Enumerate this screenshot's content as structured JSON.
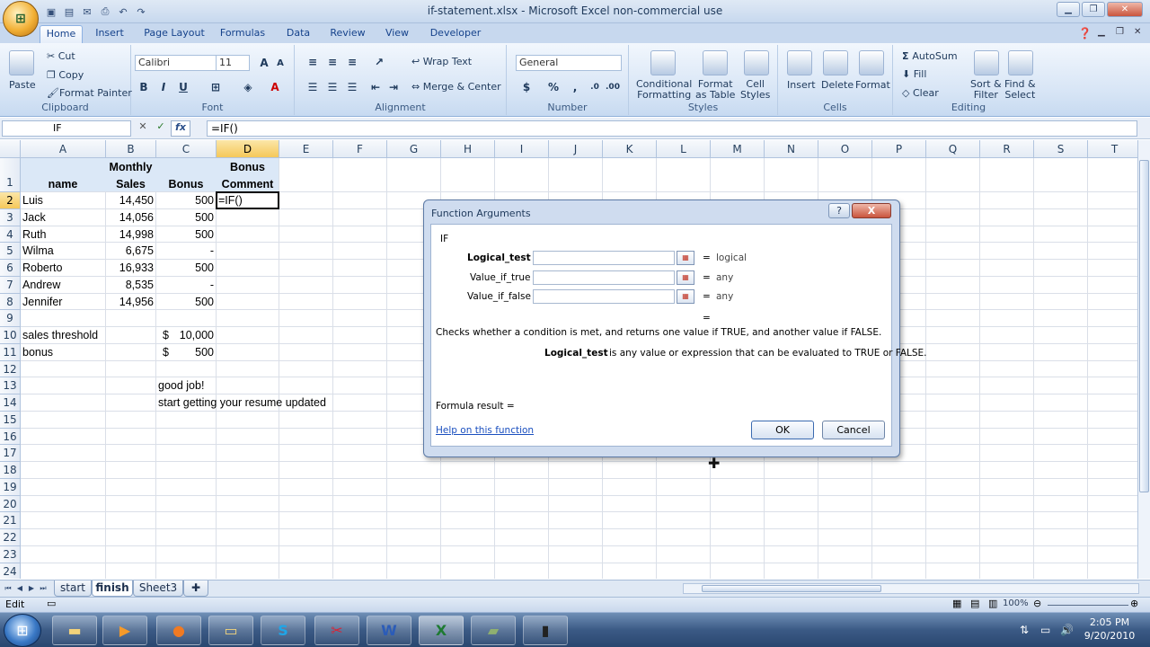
{
  "window": {
    "title": "if-statement.xlsx - Microsoft Excel non-commercial use"
  },
  "tabs": [
    "Home",
    "Insert",
    "Page Layout",
    "Formulas",
    "Data",
    "Review",
    "View",
    "Developer"
  ],
  "ribbon": {
    "clipboard": {
      "paste": "Paste",
      "cut": "Cut",
      "copy": "Copy",
      "format_painter": "Format Painter",
      "label": "Clipboard"
    },
    "font": {
      "name": "Calibri",
      "size": "11",
      "label": "Font",
      "bold": "B",
      "italic": "I",
      "underline": "U"
    },
    "alignment": {
      "wrap": "Wrap Text",
      "merge": "Merge & Center",
      "label": "Alignment"
    },
    "number": {
      "format": "General",
      "dollar": "$",
      "percent": "%",
      "label": "Number"
    },
    "styles": {
      "cond": "Conditional",
      "cond2": "Formatting",
      "fmt": "Format",
      "fmt2": "as Table",
      "cell": "Cell",
      "cell2": "Styles",
      "label": "Styles"
    },
    "cells": {
      "insert": "Insert",
      "delete": "Delete",
      "format": "Format",
      "label": "Cells"
    },
    "editing": {
      "autosum": "AutoSum",
      "fill": "Fill",
      "clear": "Clear",
      "sort": "Sort &",
      "sort2": "Filter",
      "find": "Find &",
      "find2": "Select",
      "label": "Editing"
    }
  },
  "formula_bar": {
    "name_box": "IF",
    "formula": "=IF()",
    "fx": "fx"
  },
  "columns": [
    "A",
    "B",
    "C",
    "D",
    "E",
    "F",
    "G",
    "H",
    "I",
    "J",
    "K",
    "L",
    "M",
    "N",
    "O",
    "P",
    "Q",
    "R",
    "S",
    "T"
  ],
  "rows": [
    "1",
    "2",
    "3",
    "4",
    "5",
    "6",
    "7",
    "8",
    "9",
    "10",
    "11",
    "12",
    "13",
    "14",
    "15",
    "16",
    "17",
    "18",
    "19",
    "20",
    "21",
    "22",
    "23",
    "24"
  ],
  "cells": {
    "b1a": "Monthly",
    "b1b": "Sales",
    "a1": "name",
    "c1": "Bonus",
    "d1a": "Bonus",
    "d1b": "Comment",
    "a2": "Luis",
    "b2": "14,450",
    "c2": "500",
    "d2": "=IF()",
    "a3": "Jack",
    "b3": "14,056",
    "c3": "500",
    "a4": "Ruth",
    "b4": "14,998",
    "c4": "500",
    "a5": "Wilma",
    "b5": "6,675",
    "c5": "-",
    "a6": "Roberto",
    "b6": "16,933",
    "c6": "500",
    "a7": "Andrew",
    "b7": "8,535",
    "c7": "-",
    "a8": "Jennifer",
    "b8": "14,956",
    "c8": "500",
    "a10": "sales threshold",
    "c10s": "$",
    "c10": "10,000",
    "a11": "bonus",
    "c11s": "$",
    "c11": "500",
    "c13": "good job!",
    "c14": "start getting your resume updated"
  },
  "dialog": {
    "title": "Function Arguments",
    "help_btn": "?",
    "close_btn": "X",
    "function": "IF",
    "args": [
      {
        "label": "Logical_test",
        "result": "logical"
      },
      {
        "label": "Value_if_true",
        "result": "any"
      },
      {
        "label": "Value_if_false",
        "result": "any"
      }
    ],
    "eq": "=",
    "description": "Checks whether a condition is met, and returns one value if TRUE, and another value if FALSE.",
    "arg_name": "Logical_test",
    "arg_desc": "is any value or expression that can be evaluated to TRUE or FALSE.",
    "formula_result": "Formula result =",
    "help_link": "Help on this function",
    "ok": "OK",
    "cancel": "Cancel"
  },
  "sheets": [
    "start",
    "finish",
    "Sheet3"
  ],
  "status": {
    "mode": "Edit",
    "zoom": "100%"
  },
  "clock": {
    "time": "2:05 PM",
    "date": "9/20/2010"
  }
}
